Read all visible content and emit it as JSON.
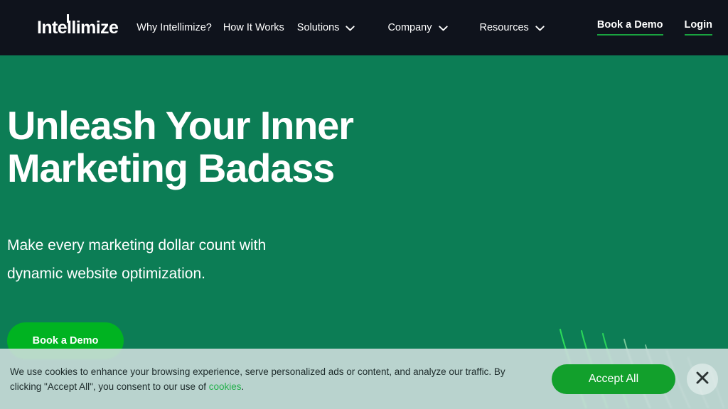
{
  "header": {
    "logo_text": "Intellimize",
    "nav": [
      {
        "label": "Why Intellimize?",
        "has_dropdown": false
      },
      {
        "label": "How It Works",
        "has_dropdown": false
      },
      {
        "label": "Solutions",
        "has_dropdown": true,
        "icon": "chevron-down-icon"
      },
      {
        "label": "Company",
        "has_dropdown": true,
        "icon": "chevron-down-icon"
      },
      {
        "label": "Resources",
        "has_dropdown": true,
        "icon": "chevron-down-icon"
      }
    ],
    "actions": [
      {
        "label": "Book a Demo"
      },
      {
        "label": "Login"
      }
    ],
    "background_color": "#0f131c",
    "underline_color": "#19a33f"
  },
  "hero": {
    "title": "Unleash Your Inner\nMarketing Badass",
    "subtitle": "Make every marketing dollar count with\ndynamic website optimization.",
    "cta_label": "Book a Demo",
    "background_color": "#0c7d55",
    "cta_color": "#00b321"
  },
  "cookie_banner": {
    "text_before_link": "We use cookies to enhance your browsing experience, serve personalized ads or content, and analyze our traffic. By clicking \"Accept All\", you consent to our use of ",
    "link_label": "cookies",
    "text_after_link": ".",
    "accept_label": "Accept All",
    "close_icon": "close-icon",
    "background_color": "#d1dfdf",
    "accept_color": "#12a02c",
    "link_color": "#22b04a"
  }
}
